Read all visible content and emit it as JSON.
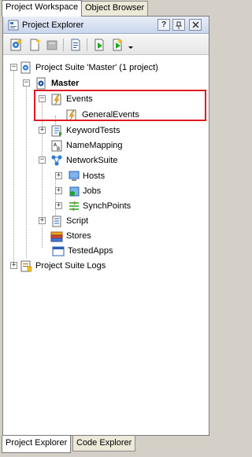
{
  "top_tabs": [
    "Project Workspace",
    "Object Browser"
  ],
  "panel": {
    "title": "Project Explorer",
    "title_buttons": [
      "?",
      "pin",
      "x"
    ]
  },
  "toolbar": {
    "icons": [
      "project-suite-icon",
      "new-item-icon",
      "remove-icon",
      "properties-icon",
      "run-icon",
      "run-with-options-icon",
      "dropdown-arrow-icon"
    ]
  },
  "tree": {
    "suite": "Project Suite 'Master' (1 project)",
    "project": "Master",
    "events": "Events",
    "general_events": "GeneralEvents",
    "keyword_tests": "KeywordTests",
    "name_mapping": "NameMapping",
    "network_suite": "NetworkSuite",
    "hosts": "Hosts",
    "jobs": "Jobs",
    "synch_points": "SynchPoints",
    "script": "Script",
    "stores": "Stores",
    "tested_apps": "TestedApps",
    "suite_logs": "Project Suite Logs"
  },
  "bottom_tabs": [
    "Project Explorer",
    "Code Explorer"
  ],
  "colors": {
    "highlight": "#e01b24",
    "title_gradient_top": "#e9eef8",
    "title_gradient_bottom": "#c9d6ec"
  }
}
